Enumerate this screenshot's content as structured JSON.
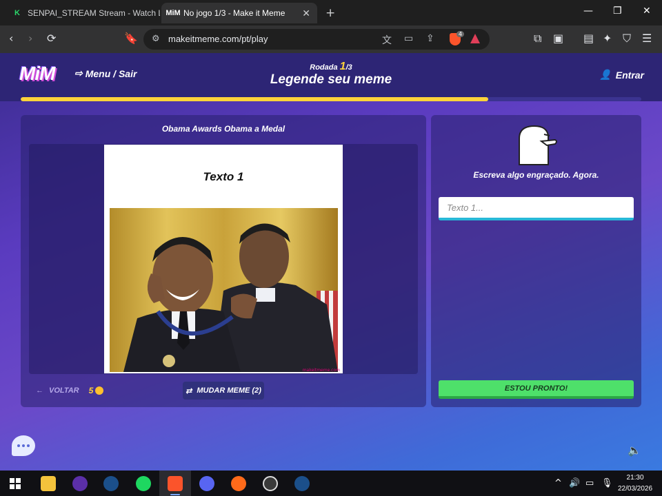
{
  "browser": {
    "tabs": [
      {
        "title": "SENPAI_STREAM Stream - Watch Live",
        "favicon": "kick-k-icon"
      },
      {
        "title": "No jogo 1/3 - Make it Meme",
        "favicon": "mim-icon"
      }
    ],
    "url": "makeitmeme.com/pt/play",
    "shield_count": "4"
  },
  "game": {
    "logo": "MiM",
    "menu_label": "Menu / Sair",
    "round_label": "Rodada",
    "round_current": "1",
    "round_total": "/3",
    "heading": "Legende seu meme",
    "login_label": "Entrar",
    "round_progress": 0.753,
    "meme": {
      "title": "Obama Awards Obama a Medal",
      "caption": "Texto 1",
      "watermark": "makeitmeme.com"
    },
    "back_label": "VOLTAR",
    "coins": "5",
    "change_label": "MUDAR MEME (2)",
    "instruction": "Escreva algo engraçado. Agora.",
    "input_placeholder": "Texto 1...",
    "input_value": "",
    "ready_label": "ESTOU PRONTO!"
  },
  "taskbar": {
    "time": "21:30",
    "date": "22/03/2026"
  },
  "colors": {
    "accent_yellow": "#ffd33a",
    "ready_green": "#4ee06a",
    "input_border": "#28b8d8",
    "header_bg": "#2d2575"
  }
}
